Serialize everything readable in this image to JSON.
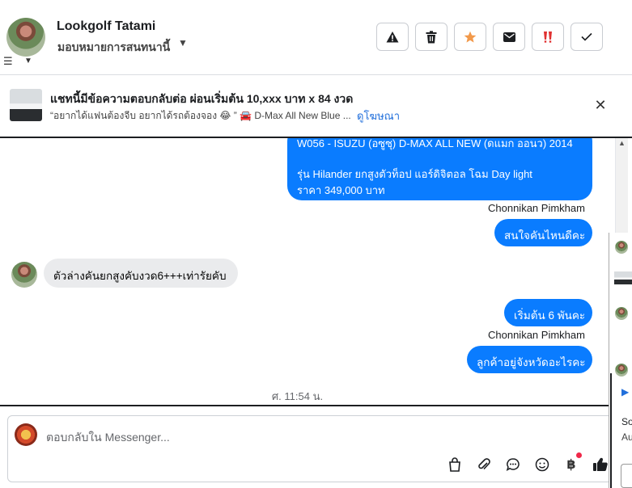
{
  "header": {
    "name": "Lookgolf Tatami",
    "subtitle": "มอบหมายการสนทนานี้",
    "actions": [
      {
        "name": "report-icon"
      },
      {
        "name": "trash-icon"
      },
      {
        "name": "star-icon",
        "color": "#f2994a"
      },
      {
        "name": "mail-icon"
      },
      {
        "name": "spam-icon",
        "color": "#e03131"
      },
      {
        "name": "check-icon"
      }
    ]
  },
  "banner": {
    "title": "แชทนี้มีข้อความตอบกลับต่อ ผ่อนเริ่มต้น 10,xxx บาท x 84 งวด",
    "subtitle": "“อยากได้แฟนต้องจีบ อยากได้รถต้องจอง 😂 ” 🚘 D-Max All New Blue ...",
    "link": "ดูโฆษณา"
  },
  "messages": {
    "out1_line1": "W056 - ISUZU (อซูซุ) D-MAX ALL NEW (ดแมก ออนว) 2014",
    "out1_line2": "รุ่น Hilander ยกสูงตัวท็อป แอร์ดิจิตอล โฉม Day light",
    "out1_line3": "ราคา 349,000 บาท",
    "sender1": "Chonnikan Pimkham",
    "out2": "สนใจคันไหนดีคะ",
    "in1": "ตัวล่างคันยกสูงคับงวด6+++เท่ารัยคับ",
    "out3": "เริ่มต้น 6 พันคะ",
    "sender2": "Chonnikan Pimkham",
    "out4": "ลูกค้าอยู่จังหวัดอะไรคะ",
    "timestamp": "ศ. 11:54 น."
  },
  "composer": {
    "placeholder": "ตอบกลับใน Messenger...",
    "tools": [
      "bag-icon",
      "paperclip-icon",
      "chat-bubble-icon",
      "smiley-icon",
      "baht-icon",
      "thumbs-up-icon"
    ],
    "baht_symbol": "฿"
  },
  "side_panel": {
    "text1": "So",
    "text2": "Au"
  },
  "colors": {
    "accent": "#0a7cff",
    "link": "#216fdb"
  }
}
